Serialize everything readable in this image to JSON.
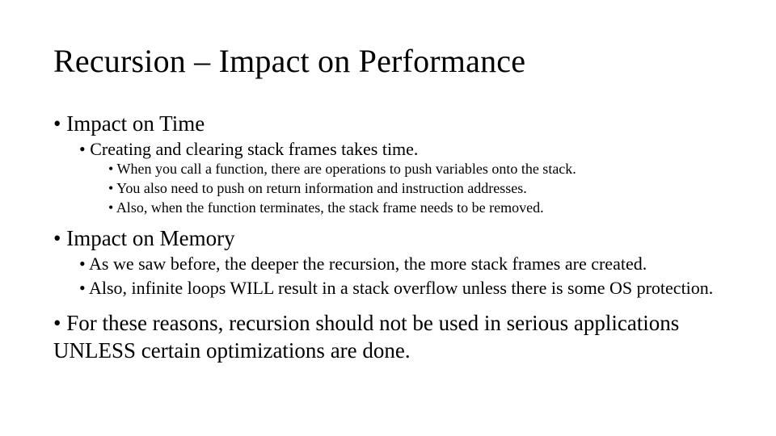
{
  "title": "Recursion – Impact on Performance",
  "b1": {
    "text": "Impact on Time",
    "sub": {
      "s1": {
        "text": "Creating and clearing stack frames takes time.",
        "sub": {
          "p1": "When you call a function, there are operations to push variables onto the stack.",
          "p2": "You also need to push on return information and instruction addresses.",
          "p3": "Also, when the function terminates, the stack frame needs to be removed."
        }
      }
    }
  },
  "b2": {
    "text": "Impact on Memory",
    "sub": {
      "s1": "As we saw before, the deeper the recursion, the more stack frames are created.",
      "s2": "Also, infinite loops WILL result in a stack overflow unless there is some OS protection."
    }
  },
  "b3": {
    "text": "For these reasons, recursion should not be used in serious applications UNLESS certain optimizations are done."
  }
}
